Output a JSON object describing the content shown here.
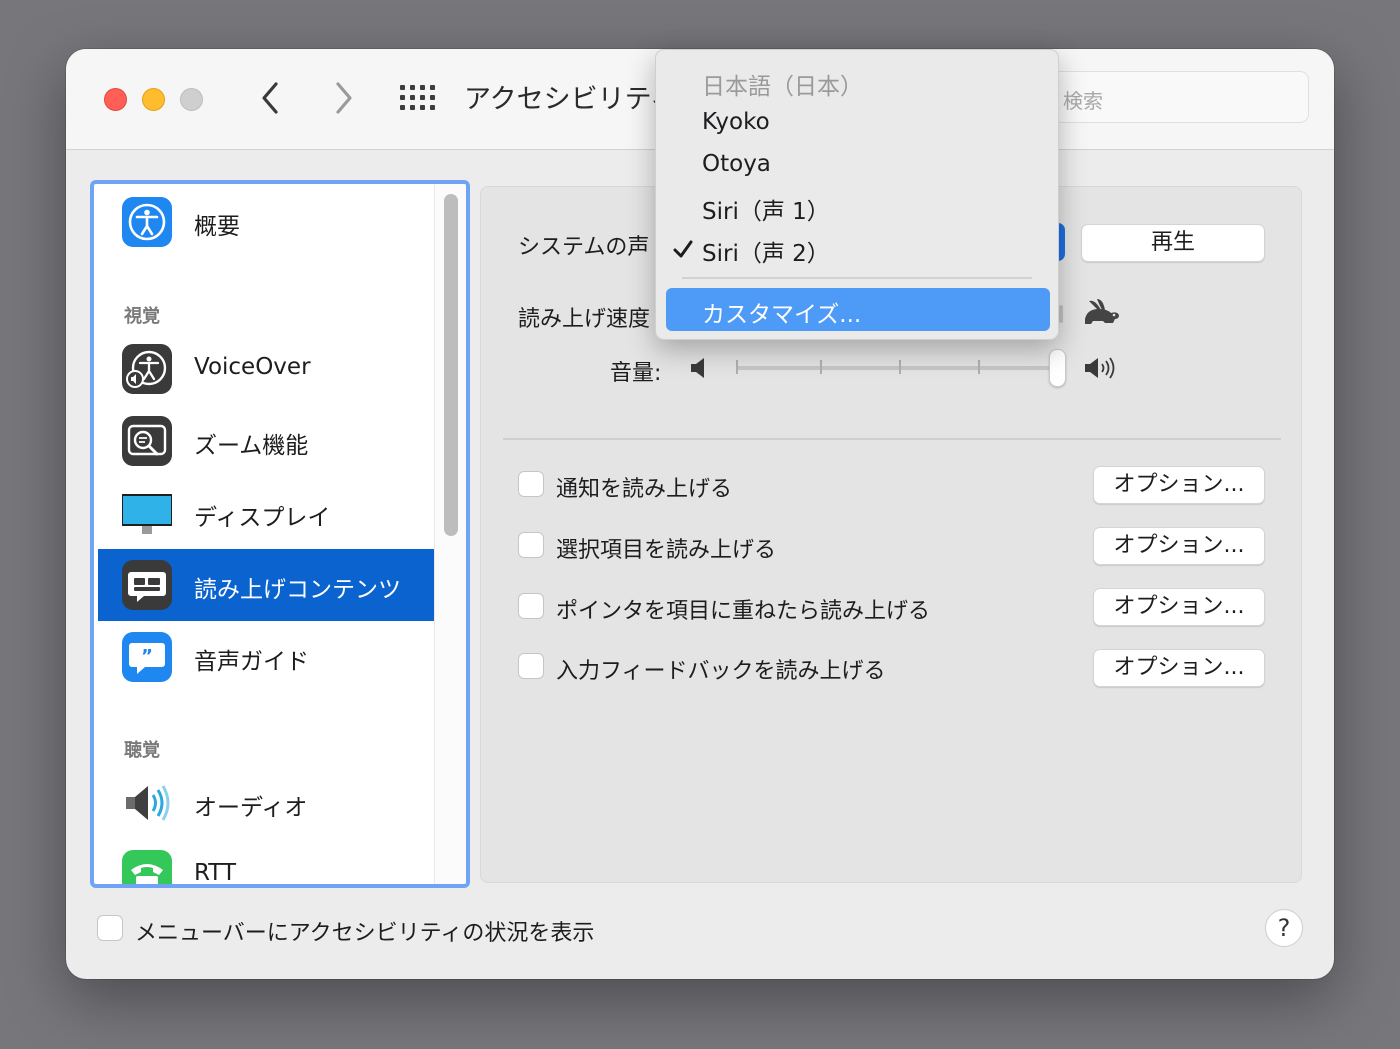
{
  "window": {
    "title": "アクセシビリティ",
    "search_placeholder": "検索"
  },
  "sidebar": {
    "items": [
      {
        "label": "概要",
        "icon": "accessibility-icon"
      },
      {
        "label": "VoiceOver",
        "icon": "voiceover-icon"
      },
      {
        "label": "ズーム機能",
        "icon": "zoom-icon"
      },
      {
        "label": "ディスプレイ",
        "icon": "display-icon"
      },
      {
        "label": "読み上げコンテンツ",
        "icon": "spoken-content-icon",
        "selected": true
      },
      {
        "label": "音声ガイド",
        "icon": "descriptions-icon"
      },
      {
        "label": "オーディオ",
        "icon": "speaker-icon"
      },
      {
        "label": "RTT",
        "icon": "rtt-phone-icon"
      }
    ],
    "sections": {
      "vision": "視覚",
      "hearing": "聴覚"
    }
  },
  "main": {
    "system_voice_label": "システムの声",
    "play_button": "再生",
    "speaking_rate_label": "読み上げ速度",
    "volume_label": "音量:",
    "volume_level": 1.0,
    "options": [
      {
        "label": "通知を読み上げる",
        "checked": false,
        "button": "オプション..."
      },
      {
        "label": "選択項目を読み上げる",
        "checked": false,
        "button": "オプション..."
      },
      {
        "label": "ポインタを項目に重ねたら読み上げる",
        "checked": false,
        "button": "オプション..."
      },
      {
        "label": "入力フィードバックを読み上げる",
        "checked": false,
        "button": "オプション..."
      }
    ]
  },
  "voice_menu": {
    "header": "日本語（日本）",
    "items": [
      "Kyoko",
      "Otoya",
      "Siri（声 1）",
      "Siri（声 2）"
    ],
    "selected_index": 3,
    "customize": "カスタマイズ..."
  },
  "footer": {
    "show_status_label": "メニューバーにアクセシビリティの状況を表示",
    "help": "?"
  },
  "colors": {
    "selection_blue": "#0a63cf",
    "menu_highlight": "#4d9af7",
    "focus_ring": "#6ea3f5"
  }
}
